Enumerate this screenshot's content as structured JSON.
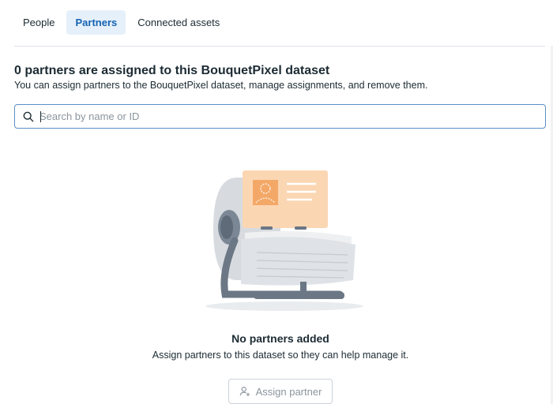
{
  "tabs": [
    {
      "label": "People",
      "active": false
    },
    {
      "label": "Partners",
      "active": true
    },
    {
      "label": "Connected assets",
      "active": false
    }
  ],
  "header": {
    "title": "0 partners are assigned to this BouquetPixel dataset",
    "description": "You can assign partners to the BouquetPixel dataset, manage assignments, and remove them."
  },
  "search": {
    "placeholder": "Search by name or ID",
    "value": "",
    "icon": "search-icon"
  },
  "empty_state": {
    "title": "No partners added",
    "description": "Assign partners to this dataset so they can help manage it.",
    "illustration": "rolodex-illustration"
  },
  "assign_button": {
    "label": "Assign partner",
    "icon": "add-person-icon"
  },
  "colors": {
    "accent": "#1463b1",
    "active_tab_bg": "#e6f0fa",
    "card_orange": "#fbd6b3",
    "avatar_orange": "#f4a867"
  }
}
